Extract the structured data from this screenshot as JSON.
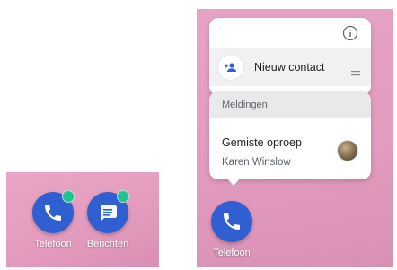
{
  "left_panel": {
    "apps": [
      {
        "name": "Telefoon",
        "icon": "phone-icon",
        "badge": true
      },
      {
        "name": "Berichten",
        "icon": "message-icon",
        "badge": true
      }
    ]
  },
  "right_panel": {
    "shortcut_menu": {
      "info_icon": "info-icon",
      "shortcut": {
        "label": "Nieuw contact",
        "icon": "add-contact-icon"
      }
    },
    "notification": {
      "header": "Meldingen",
      "title": "Gemiste oproep",
      "subtitle": "Karen Winslow",
      "avatar": "contact-avatar"
    },
    "app": {
      "name": "Telefoon",
      "icon": "phone-icon"
    }
  },
  "colors": {
    "wallpaper": "#e39bbd",
    "app_icon_bg": "#2f5fd0",
    "badge": "#1fc38f",
    "card_bg": "#ffffff"
  }
}
